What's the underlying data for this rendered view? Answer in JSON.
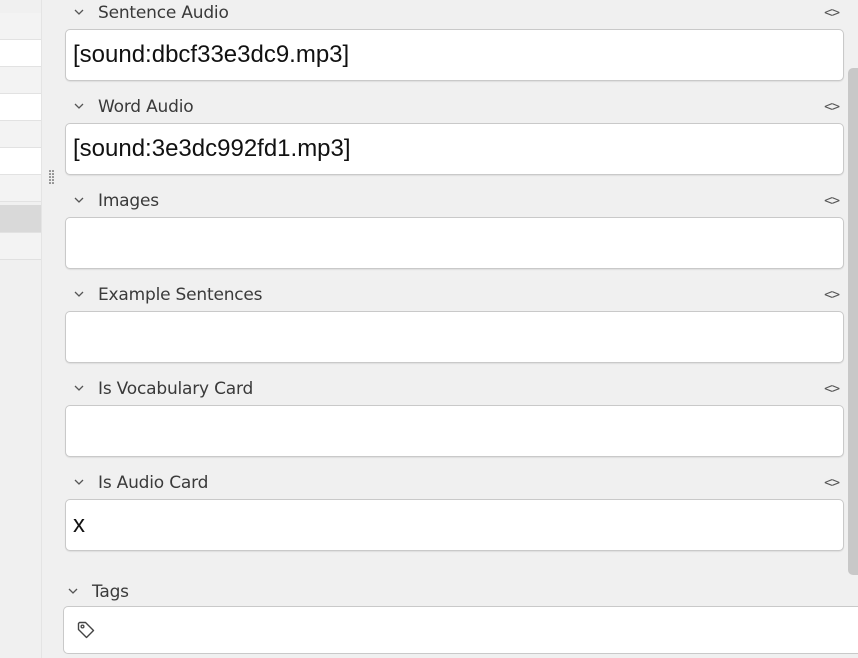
{
  "fields": [
    {
      "name": "Sentence Audio",
      "value": "[sound:dbcf33e3dc9.mp3]"
    },
    {
      "name": "Word Audio",
      "value": "[sound:3e3dc992fd1.mp3]"
    },
    {
      "name": "Images",
      "value": ""
    },
    {
      "name": "Example Sentences",
      "value": ""
    },
    {
      "name": "Is Vocabulary Card",
      "value": ""
    },
    {
      "name": "Is Audio Card",
      "value": "x"
    }
  ],
  "toggle_glyph": "<>",
  "tags": {
    "label": "Tags",
    "value": ""
  },
  "icons": {
    "collapse": "chevron-down-icon",
    "html_toggle": "code-toggle-icon",
    "tag": "tag-icon",
    "splitter": "drag-handle-icon"
  },
  "colors": {
    "background": "#f0f0f0",
    "field_background": "#ffffff",
    "border": "#c9c9c9",
    "scrollbar": "#c8c8c8"
  }
}
